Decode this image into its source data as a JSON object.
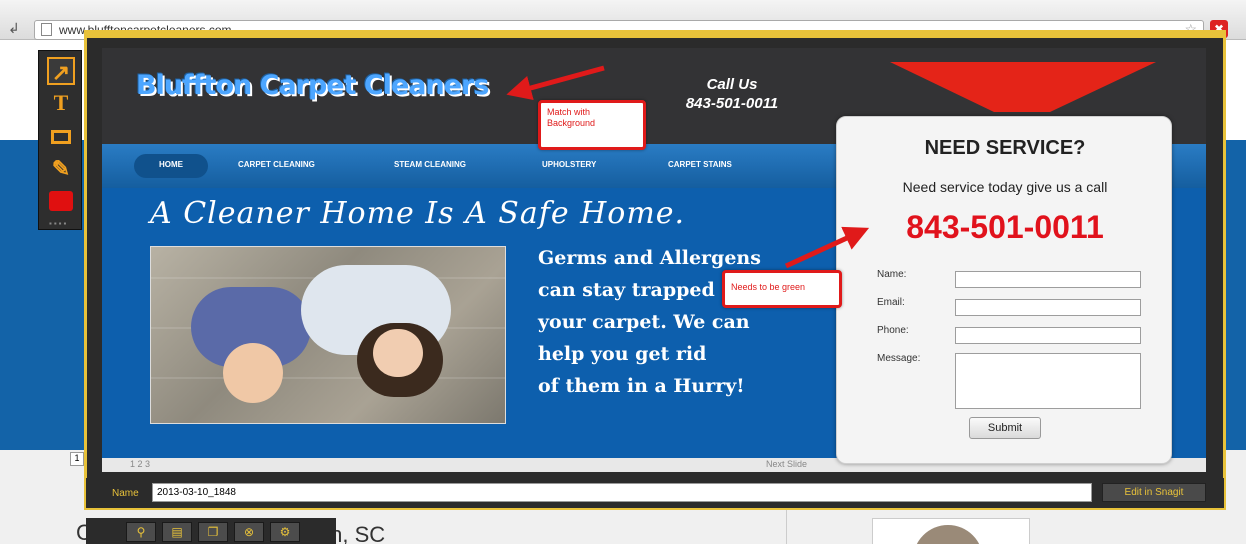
{
  "browser": {
    "url": "www.blufftoncarpetcleaners.com"
  },
  "background_page": {
    "location_text": "ffton, SC",
    "left_letter": "C",
    "tab_glyph": "1"
  },
  "site": {
    "logo": "Bluffton Carpet Cleaners",
    "call_us_label": "Call Us",
    "call_us_phone": "843-501-0011",
    "nav": [
      "HOME",
      "CARPET CLEANING",
      "STEAM CLEANING",
      "UPHOLSTERY",
      "CARPET STAINS"
    ],
    "headline": "A Cleaner Home Is A Safe Home.",
    "copy_lines": [
      "Germs and Allergens",
      "can stay trapped in",
      "your carpet. We can",
      "help you get rid",
      "of them in a Hurry!"
    ],
    "slide_pages": "1 2 3",
    "slide_next": "Next Slide"
  },
  "service_form": {
    "title": "NEED SERVICE?",
    "subtitle": "Need service today give us a call",
    "phone": "843-501-0011",
    "labels": {
      "name": "Name:",
      "email": "Email:",
      "phone": "Phone:",
      "message": "Message:"
    },
    "submit": "Submit"
  },
  "annotations": {
    "callout_background": "Match with Background",
    "callout_green": "Needs to be green",
    "color_arrow": "#e01a1a"
  },
  "snagit": {
    "name_label": "Name",
    "name_value": "2013-03-10_1848",
    "edit_button": "Edit in Snagit",
    "tools": [
      "arrow-tool-icon",
      "text-tool-icon",
      "rectangle-tool-icon",
      "highlighter-tool-icon",
      "color-swatch-icon"
    ],
    "accent": "#e8c23a"
  }
}
